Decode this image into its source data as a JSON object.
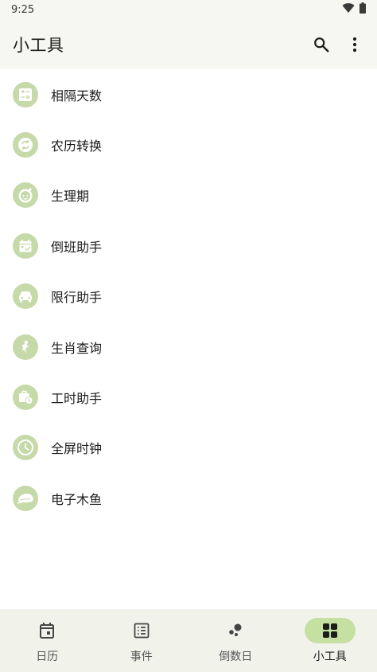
{
  "status_bar": {
    "time": "9:25",
    "icons": [
      "wifi-icon",
      "battery-icon"
    ]
  },
  "app_bar": {
    "title": "小工具",
    "actions": [
      "search-icon",
      "more-vert-icon"
    ]
  },
  "colors": {
    "accent_circle": "#c5d9a9",
    "icon_fg": "#ffffff",
    "nav_active": "#c5e0a0",
    "bar_bg": "#f6f6f2"
  },
  "tools": [
    {
      "label": "相隔天数",
      "icon": "calculator-icon"
    },
    {
      "label": "农历转换",
      "icon": "convert-icon"
    },
    {
      "label": "生理期",
      "icon": "baby-face-icon"
    },
    {
      "label": "倒班助手",
      "icon": "calendar-check-icon"
    },
    {
      "label": "限行助手",
      "icon": "car-icon"
    },
    {
      "label": "生肖查询",
      "icon": "zodiac-icon"
    },
    {
      "label": "工时助手",
      "icon": "work-clock-icon"
    },
    {
      "label": "全屏时钟",
      "icon": "clock-icon"
    },
    {
      "label": "电子木鱼",
      "icon": "wooden-fish-icon"
    }
  ],
  "bottom_nav": [
    {
      "label": "日历",
      "icon": "calendar-icon",
      "active": false
    },
    {
      "label": "事件",
      "icon": "list-icon",
      "active": false
    },
    {
      "label": "倒数日",
      "icon": "bubbles-icon",
      "active": false
    },
    {
      "label": "小工具",
      "icon": "grid-icon",
      "active": true
    }
  ]
}
